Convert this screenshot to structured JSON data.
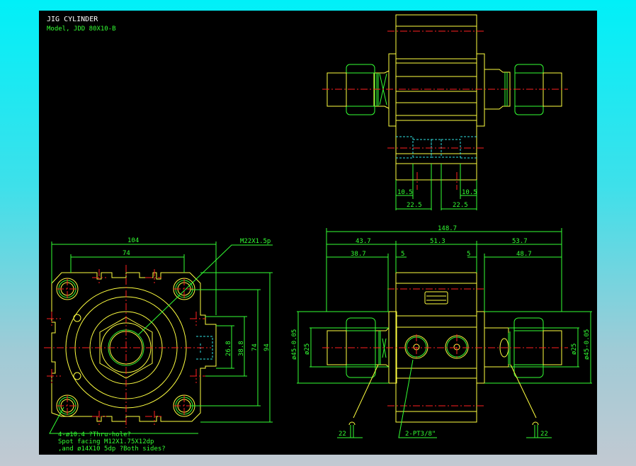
{
  "title": {
    "line1": "JIG CYLINDER",
    "line2": "Model, JDD 80X10-B"
  },
  "colors": {
    "background_top": "#00f0f8",
    "background_bottom": "#c2c9d2",
    "canvas": "#000000",
    "outline": "#ffff40",
    "dimension": "#33ff33",
    "centerline": "#ff2020",
    "hidden": "#30e0e0"
  },
  "top_view": {
    "dims": {
      "left_small": "10.5",
      "right_small": "10.5",
      "left_large": "22.5",
      "right_large": "22.5"
    }
  },
  "front_view": {
    "dims": {
      "width_outer": "104",
      "width_inner": "74",
      "height_outer": "94",
      "height_inner": "74",
      "port_outer": "38.8",
      "port_inner": "26.8"
    },
    "thread_callout": "M22X1.5p",
    "notes": [
      "4-ø10.4 ?Thru-hole?",
      "Spot facing  M12X1.75X12dp",
      ",and ø14X10 5dp ?Both sides?"
    ]
  },
  "side_view": {
    "dims": {
      "total": "148.7",
      "left": "43.7",
      "middle": "51.3",
      "right": "53.7",
      "left_inner": "38.7",
      "gap_left": "5",
      "gap_right": "5",
      "right_inner": "48.7",
      "dia_outer_left": "ø45-0.05",
      "dia_inner_left": "ø25",
      "dia_inner_right": "ø25",
      "dia_outer_right": "ø45-0.05"
    },
    "port_callout": "2-PT3/8\"",
    "wrench_left": "22",
    "wrench_right": "22"
  }
}
